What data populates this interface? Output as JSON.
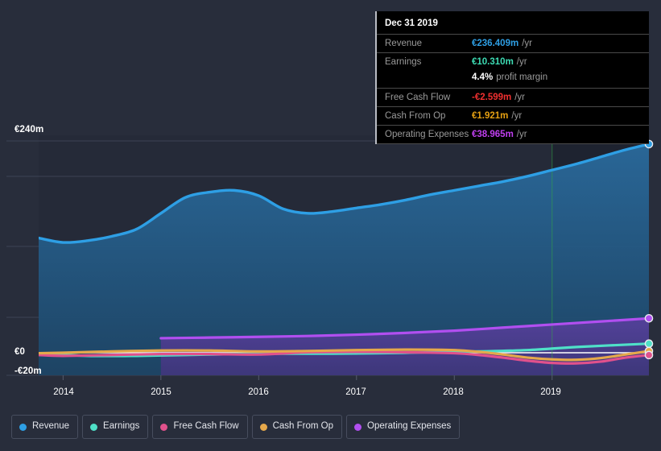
{
  "chart_data": {
    "type": "area",
    "title": "",
    "xlabel": "",
    "ylabel": "",
    "grid": true,
    "legend_position": "bottom-left",
    "x_ticks": [
      "2014",
      "2015",
      "2016",
      "2017",
      "2018",
      "2019"
    ],
    "y_ticks": [
      "€240m",
      "€0",
      "-€20m"
    ],
    "ylim": [
      -20,
      260
    ],
    "xlim": [
      2013.75,
      2019.99
    ],
    "currency": "€",
    "units": "m",
    "series": [
      {
        "name": "Revenue",
        "color": "#2e9fe5",
        "fill": "#1f4a6e",
        "x": [
          2013.75,
          2014.0,
          2014.25,
          2014.5,
          2014.75,
          2015.0,
          2015.25,
          2015.5,
          2015.75,
          2016.0,
          2016.25,
          2016.5,
          2016.75,
          2017.0,
          2017.25,
          2017.5,
          2017.75,
          2018.0,
          2018.25,
          2018.5,
          2018.75,
          2019.0,
          2019.25,
          2019.5,
          2019.75,
          2019.99
        ],
        "values": [
          130.0,
          125.0,
          127.0,
          132.0,
          140.0,
          158.0,
          176.0,
          182.0,
          184.0,
          178.0,
          163.0,
          158.0,
          160.0,
          164.0,
          168.0,
          173.0,
          179.0,
          184.0,
          189.0,
          194.0,
          200.0,
          207.0,
          214.0,
          222.0,
          230.0,
          236.409
        ]
      },
      {
        "name": "Earnings",
        "color": "#4fe0c8",
        "x": [
          2013.75,
          2014.25,
          2014.75,
          2015.25,
          2015.75,
          2016.25,
          2016.75,
          2017.25,
          2017.75,
          2018.25,
          2018.75,
          2019.25,
          2019.99
        ],
        "values": [
          -1.0,
          -3.5,
          -3.5,
          -2.5,
          -1.5,
          -1.0,
          -1.0,
          -0.5,
          0.5,
          1.5,
          3.0,
          6.5,
          10.31
        ]
      },
      {
        "name": "Free Cash Flow",
        "color": "#e0518c",
        "x": [
          2013.75,
          2014.0,
          2014.5,
          2015.0,
          2015.5,
          2016.0,
          2016.5,
          2017.0,
          2017.5,
          2018.0,
          2018.25,
          2018.5,
          2018.75,
          2019.0,
          2019.25,
          2019.5,
          2019.75,
          2019.99
        ],
        "values": [
          -2.5,
          -3.5,
          -2.5,
          -1.5,
          -1.5,
          -2.0,
          0.5,
          1.0,
          0.5,
          -0.5,
          -2.5,
          -5.5,
          -9.0,
          -11.5,
          -12.0,
          -10.0,
          -5.5,
          -2.599
        ]
      },
      {
        "name": "Cash From Op",
        "color": "#e5a84b",
        "x": [
          2013.75,
          2014.0,
          2014.5,
          2015.0,
          2015.5,
          2016.0,
          2016.5,
          2017.0,
          2017.5,
          2018.0,
          2018.25,
          2018.5,
          2018.75,
          2019.0,
          2019.25,
          2019.5,
          2019.75,
          2019.99
        ],
        "values": [
          -0.5,
          0.0,
          1.5,
          2.5,
          2.5,
          1.5,
          2.0,
          3.0,
          3.5,
          3.0,
          1.0,
          -2.0,
          -5.5,
          -7.5,
          -8.0,
          -6.0,
          -2.0,
          1.921
        ]
      },
      {
        "name": "Operating Expenses",
        "color": "#b14ff0",
        "fill": "#3b2f62",
        "x": [
          2015.0,
          2015.5,
          2016.0,
          2016.5,
          2017.0,
          2017.5,
          2018.0,
          2018.5,
          2019.0,
          2019.5,
          2019.99
        ],
        "values": [
          16.5,
          17.2,
          18.0,
          19.0,
          20.5,
          22.5,
          25.0,
          28.5,
          32.0,
          35.5,
          38.965
        ]
      }
    ],
    "end_markers": [
      {
        "series": "Revenue",
        "value": 236.409
      },
      {
        "series": "Operating Expenses",
        "value": 38.965
      },
      {
        "series": "Earnings",
        "value": 10.31
      },
      {
        "series": "Cash From Op",
        "value": 1.921
      },
      {
        "series": "Free Cash Flow",
        "value": -2.599
      }
    ]
  },
  "axis": {
    "y_top_label": "€240m",
    "y_zero_label": "€0",
    "y_bottom_label": "-€20m",
    "x_ticks": [
      "2014",
      "2015",
      "2016",
      "2017",
      "2018",
      "2019"
    ]
  },
  "tooltip": {
    "title": "Dec 31 2019",
    "rows": [
      {
        "label": "Revenue",
        "value": "€236.409m",
        "unit": "/yr",
        "color": "#2e9fe5"
      },
      {
        "label": "Earnings",
        "value": "€10.310m",
        "unit": "/yr",
        "color": "#3ddcb4"
      },
      {
        "label": "",
        "value": "4.4%",
        "unit": "",
        "sub": "profit margin",
        "color": "#ffffff"
      },
      {
        "label": "Free Cash Flow",
        "value": "-€2.599m",
        "unit": "/yr",
        "color": "#f03030"
      },
      {
        "label": "Cash From Op",
        "value": "€1.921m",
        "unit": "/yr",
        "color": "#e5a012"
      },
      {
        "label": "Operating Expenses",
        "value": "€38.965m",
        "unit": "/yr",
        "color": "#c03ff0"
      }
    ]
  },
  "legend": {
    "items": [
      {
        "label": "Revenue",
        "color": "#2e9fe5"
      },
      {
        "label": "Earnings",
        "color": "#4fe0c8"
      },
      {
        "label": "Free Cash Flow",
        "color": "#e0518c"
      },
      {
        "label": "Cash From Op",
        "color": "#e5a84b"
      },
      {
        "label": "Operating Expenses",
        "color": "#b14ff0"
      }
    ]
  },
  "colors": {
    "background": "#282d3b",
    "plot_recent_band": "#1d2230",
    "gridline": "#3d4354",
    "zero_line": "#ffffff",
    "tooltip_bg": "#000000",
    "tooltip_border": "#b9bcc4"
  }
}
